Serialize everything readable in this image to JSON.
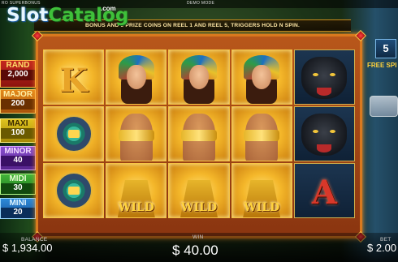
{
  "top_bar": {
    "mode_left": "RO SUPERBONUS",
    "mode_center": "DEMO MODE"
  },
  "watermark": {
    "slot": "Slot",
    "catalog": "Catalog",
    "com": ".com"
  },
  "banner": {
    "text": "BONUS AND 3 PRIZE COINS ON REEL 1 AND REEL 5, TRIGGERS HOLD N SPIN."
  },
  "jackpots": [
    {
      "name": "RAND",
      "value": "2,000"
    },
    {
      "name": "MAJOR",
      "value": "200"
    },
    {
      "name": "MAXI",
      "value": "100"
    },
    {
      "name": "MINOR",
      "value": "40"
    },
    {
      "name": "MIDI",
      "value": "30"
    },
    {
      "name": "MINI",
      "value": "20"
    }
  ],
  "reels": {
    "symbols": [
      [
        "K",
        "woman",
        "woman",
        "woman",
        "panther"
      ],
      [
        "bonus-coin",
        "wild-woman",
        "wild-woman",
        "wild-woman",
        "panther"
      ],
      [
        "bonus-coin",
        "wild",
        "wild",
        "wild",
        "A"
      ]
    ],
    "wild_label": "WILD",
    "letter_K": "K",
    "letter_A": "A"
  },
  "free_spins": {
    "count": "5",
    "label": "FREE SPI"
  },
  "footer": {
    "balance_label": "BALANCE",
    "balance_value": "$ 1,934.00",
    "win_label": "WIN",
    "win_value": "$ 40.00",
    "bet_label": "BET",
    "bet_value": "$ 2.00"
  },
  "colors": {
    "frame": "#d9791e",
    "highlight": "#f4b72a",
    "wild_text": "#ffd23a"
  }
}
